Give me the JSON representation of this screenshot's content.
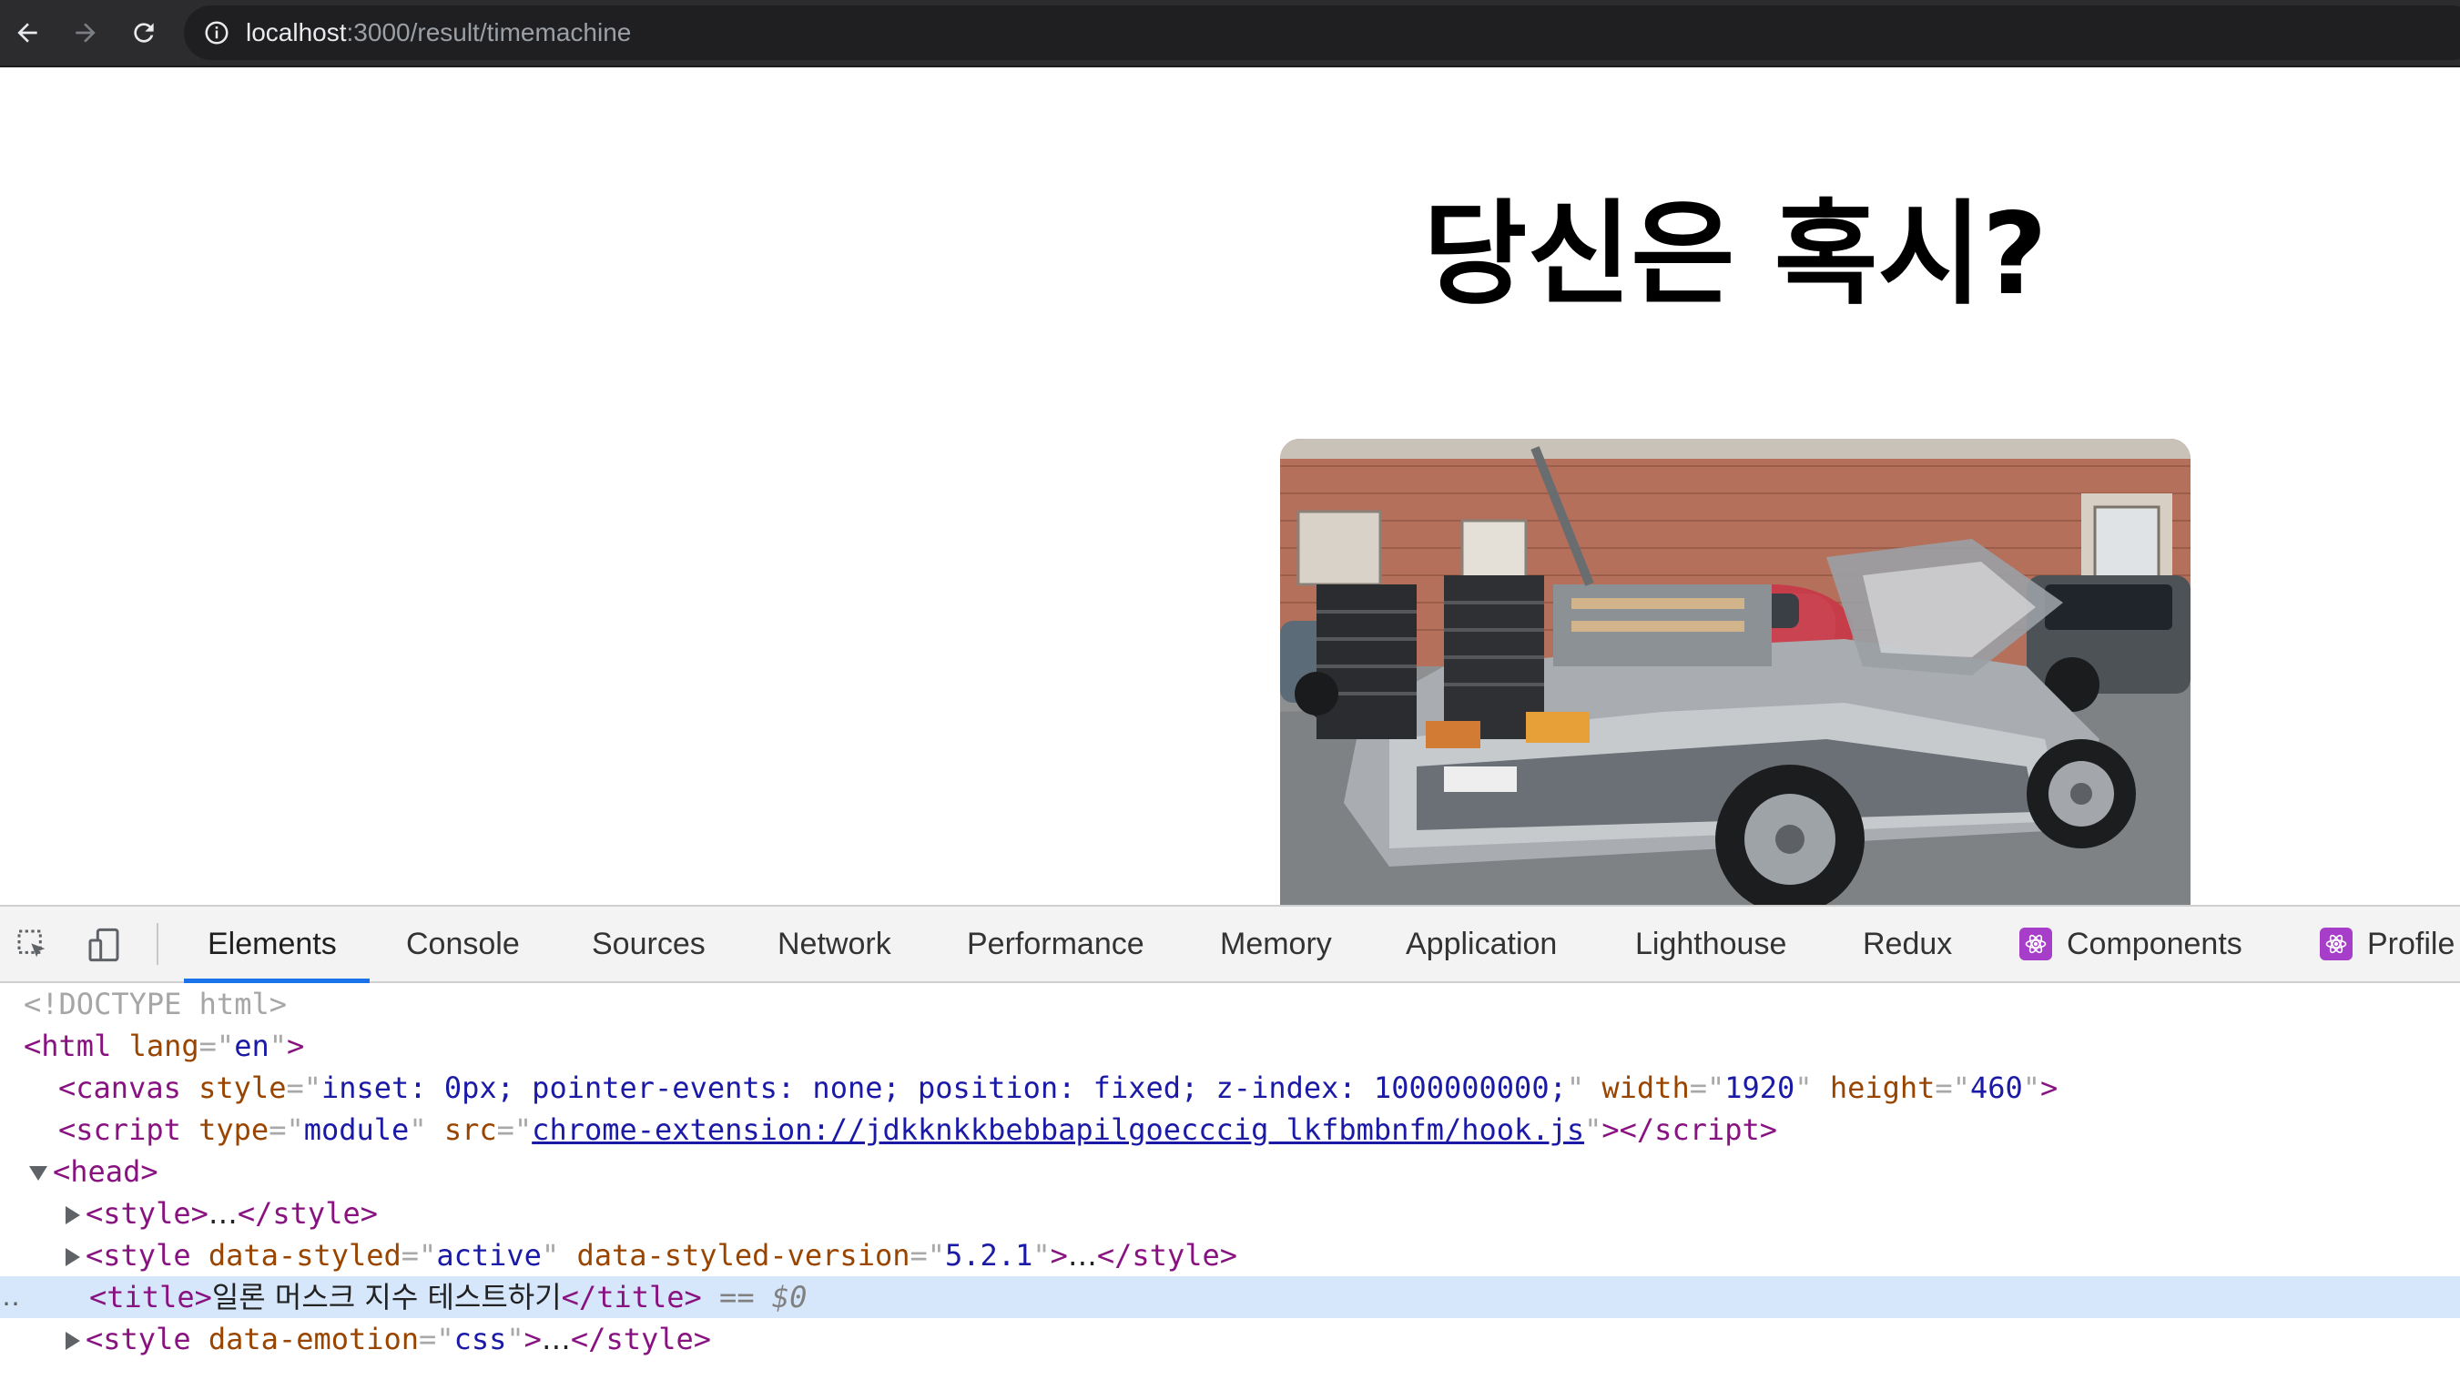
{
  "browser": {
    "url_host": "localhost",
    "url_path": ":3000/result/timemachine",
    "icons": {
      "back": "arrow-left-icon",
      "forward": "arrow-right-icon",
      "reload": "reload-icon",
      "site_info": "info-icon"
    }
  },
  "page": {
    "heading": "당신은 혹시?",
    "hero_image": "DeLorean time machine car photo"
  },
  "devtools": {
    "tabs": [
      {
        "label": "Elements",
        "active": true
      },
      {
        "label": "Console"
      },
      {
        "label": "Sources"
      },
      {
        "label": "Network"
      },
      {
        "label": "Performance"
      },
      {
        "label": "Memory"
      },
      {
        "label": "Application"
      },
      {
        "label": "Lighthouse"
      },
      {
        "label": "Redux"
      },
      {
        "label": "Components",
        "icon": "react-icon"
      },
      {
        "label": "Profile",
        "icon": "react-icon"
      }
    ],
    "tree": {
      "doctype": "<!DOCTYPE html>",
      "html_tag": "html",
      "lang_attr": "lang",
      "lang_val": "en",
      "canvas_tag": "canvas",
      "canvas_style_attr": "style",
      "canvas_style_val": "inset: 0px; pointer-events: none; position: fixed; z-index: 1000000000;",
      "canvas_width_attr": "width",
      "canvas_width_val": "1920",
      "canvas_height_attr": "height",
      "canvas_height_val": "460",
      "script_tag": "script",
      "script_type_attr": "type",
      "script_type_val": "module",
      "script_src_attr": "src",
      "script_src_val": "chrome-extension://jdkknkkbebbapilgoecccig lkfbmbnfm/hook.js",
      "head_tag": "head",
      "style_tag": "style",
      "ellipsis": "…",
      "styled_attr": "data-styled",
      "styled_val": "active",
      "styled_version_attr": "data-styled-version",
      "styled_version_val": "5.2.1",
      "title_tag": "title",
      "title_text": "일론 머스크 지수 테스트하기",
      "eq": "==",
      "dollar": "$0",
      "gutter": "‥",
      "emotion_attr": "data-emotion",
      "emotion_val": "css"
    }
  }
}
